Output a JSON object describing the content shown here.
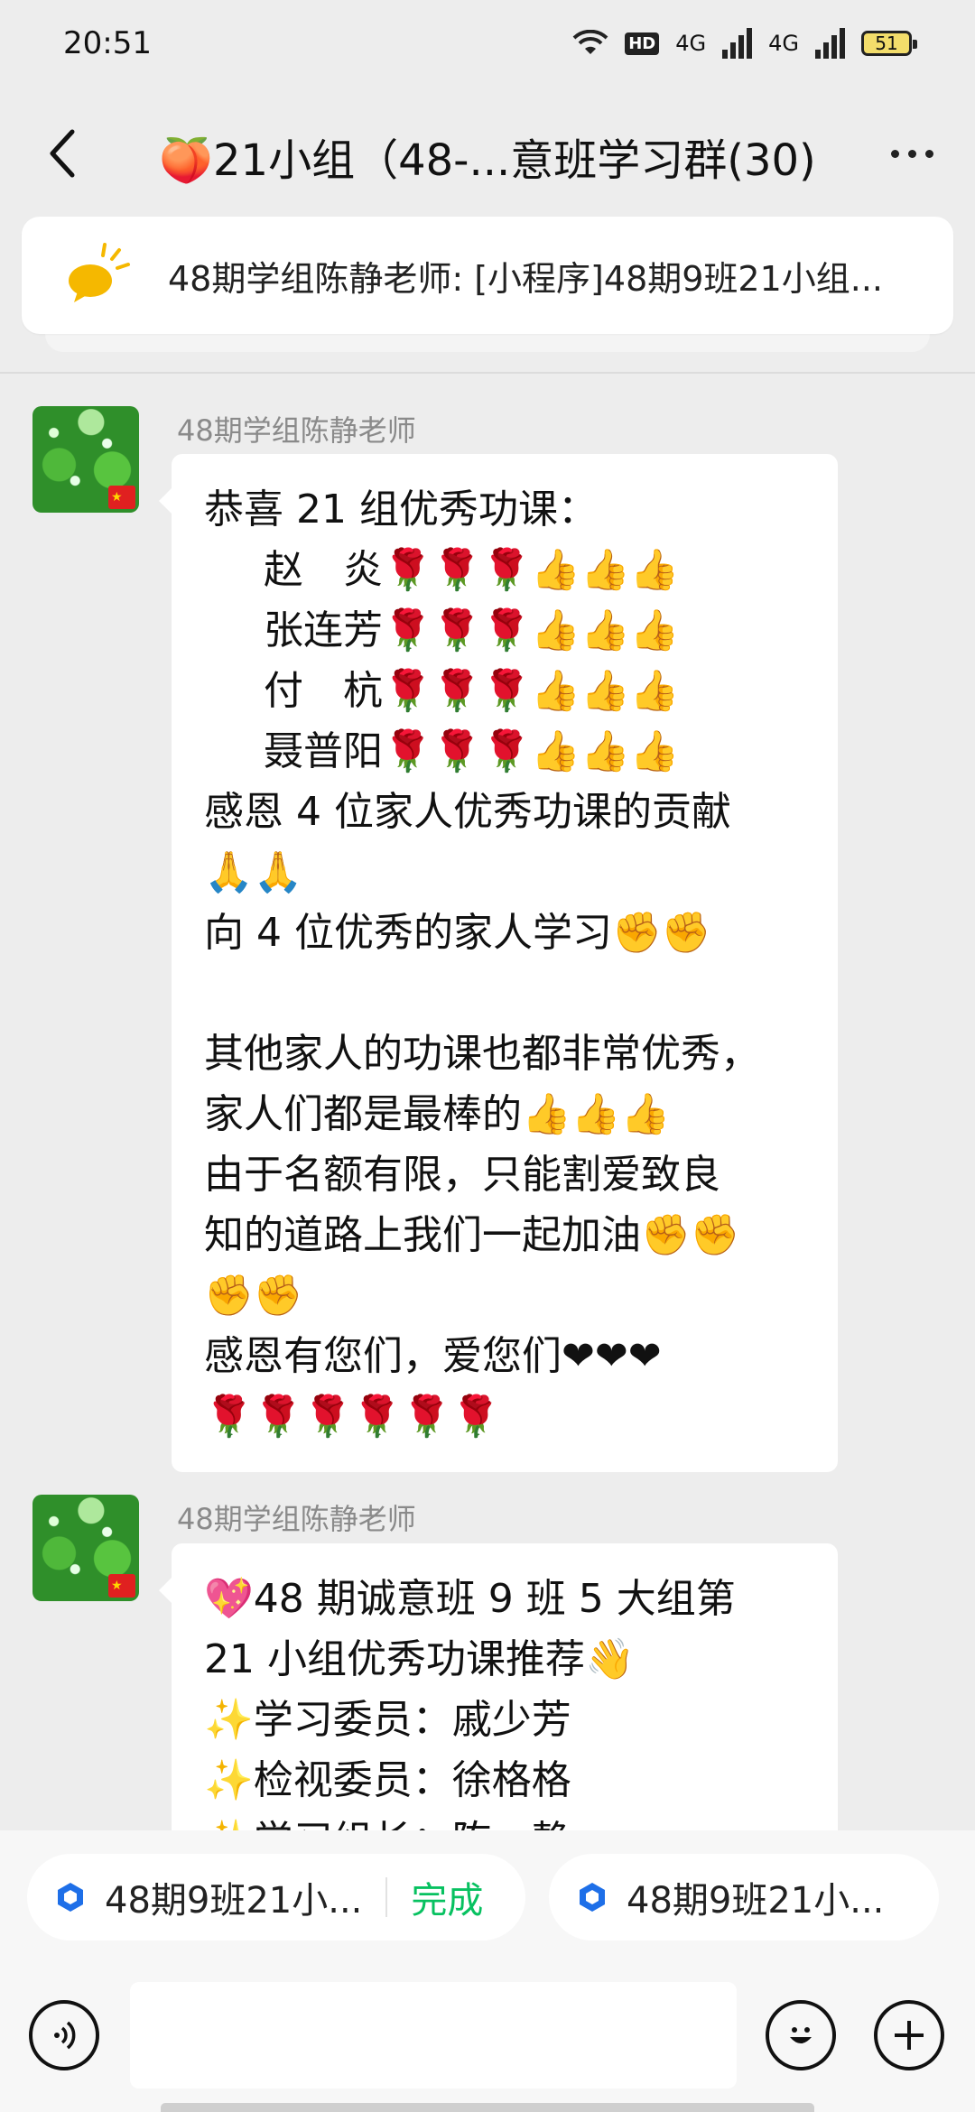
{
  "status_bar": {
    "time": "20:51",
    "hd_label": "HD",
    "network_1": "4G",
    "network_2": "4G",
    "battery": "51"
  },
  "nav": {
    "title": "🍑21小组（48-...意班学习群(30)",
    "back_icon": "chevron-left-icon",
    "more_icon": "more-dots-icon"
  },
  "pinned": {
    "text": "48期学组陈静老师: [小程序]48期9班21小组..."
  },
  "messages": [
    {
      "sender": "48期学组陈静老师",
      "lines": [
        {
          "text": "恭喜 21 组优秀功课：",
          "indent": false
        },
        {
          "text": "赵　炎🌹🌹🌹👍👍👍",
          "indent": true
        },
        {
          "text": "张连芳🌹🌹🌹👍👍👍",
          "indent": true
        },
        {
          "text": "付　杭🌹🌹🌹👍👍👍",
          "indent": true
        },
        {
          "text": "聂普阳🌹🌹🌹👍👍👍",
          "indent": true
        },
        {
          "text": "感恩 4 位家人优秀功课的贡献",
          "indent": false
        },
        {
          "text": "🙏🙏",
          "indent": false
        },
        {
          "text": "向 4 位优秀的家人学习✊✊",
          "indent": false
        },
        {
          "text": "",
          "indent": false
        },
        {
          "text": "其他家人的功课也都非常优秀，",
          "indent": false
        },
        {
          "text": "家人们都是最棒的👍👍👍",
          "indent": false
        },
        {
          "text": "由于名额有限，只能割爱致良",
          "indent": false
        },
        {
          "text": "知的道路上我们一起加油✊✊",
          "indent": false
        },
        {
          "text": "✊✊",
          "indent": false
        },
        {
          "text": "感恩有您们，爱您们❤❤❤",
          "indent": false
        },
        {
          "text": "🌹🌹🌹🌹🌹🌹",
          "indent": false
        }
      ]
    },
    {
      "sender": "48期学组陈静老师",
      "lines": [
        {
          "text": "💖48 期诚意班 9 班 5 大组第",
          "indent": false
        },
        {
          "text": "21 小组优秀功课推荐👋",
          "indent": false
        },
        {
          "text": "✨学习委员：戚少芳",
          "indent": false
        },
        {
          "text": "✨检视委员：徐格格",
          "indent": false
        },
        {
          "text": "✨学习组长：陈　静",
          "indent": false
        }
      ]
    }
  ],
  "chips": [
    {
      "label": "48期9班21小...",
      "action": "完成"
    },
    {
      "label": "48期9班21小..."
    }
  ],
  "input": {
    "placeholder": ""
  },
  "colors": {
    "background": "#ededed",
    "bubble": "#ffffff",
    "accent_green": "#07c160",
    "sender_gray": "#8a8a8a"
  }
}
